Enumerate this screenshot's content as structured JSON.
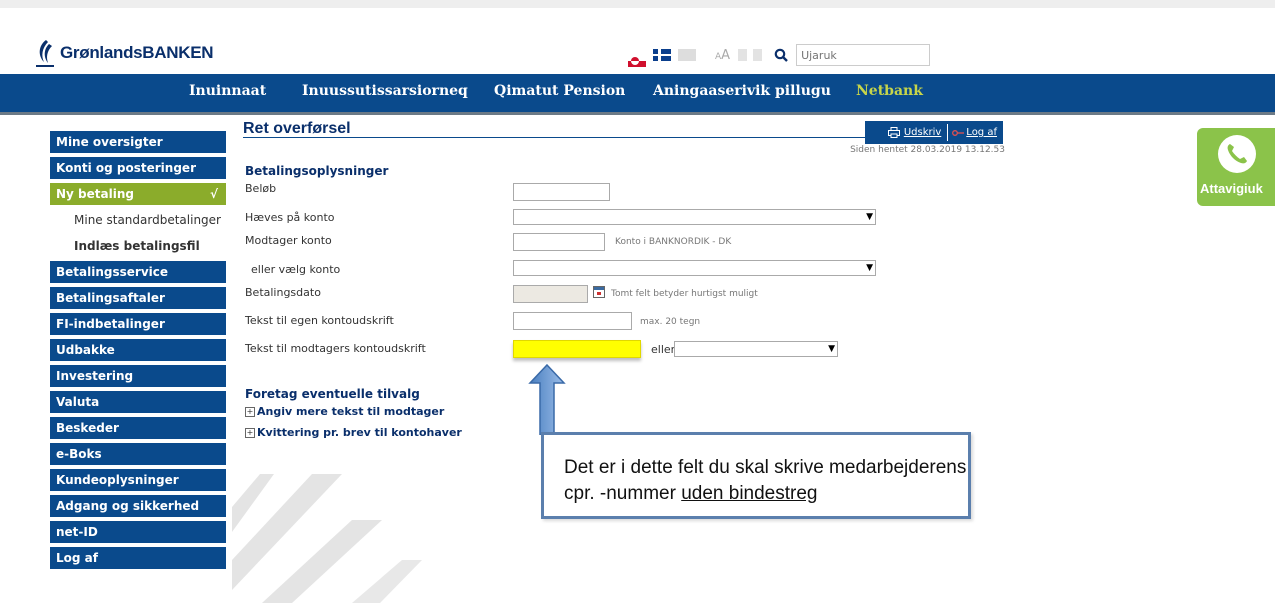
{
  "header": {
    "logo_text": "GrønlandsBANKEN",
    "font_size_label": "A",
    "font_size_small": "A",
    "search_placeholder": "Ujaruk"
  },
  "nav": {
    "items": [
      "Inuinnaat",
      "Inuussutissarsiorneq",
      "Qimatut Pension",
      "Aningaaserivik pillugu",
      "Netbank"
    ]
  },
  "sidebar": {
    "items": [
      "Mine oversigter",
      "Konti og posteringer",
      "Ny betaling",
      "Mine standardbetalinger",
      "Indlæs betalingsfil",
      "Betalingsservice",
      "Betalingsaftaler",
      "FI-indbetalinger",
      "Udbakke",
      "Investering",
      "Valuta",
      "Beskeder",
      "e-Boks",
      "Kundeoplysninger",
      "Adgang og sikkerhed",
      "net-ID",
      "Log af"
    ],
    "check": "√"
  },
  "page": {
    "title": "Ret overførsel",
    "print": "Udskriv",
    "logout": "Log af",
    "fetched": "Siden hentet 28.03.2019 13.12.53"
  },
  "form": {
    "section": "Betalingsoplysninger",
    "amount": "Beløb",
    "from_account": "Hæves på konto",
    "to_account": "Modtager konto",
    "to_account_hint": "Konto i BANKNORDIK - DK",
    "or_choose": "eller vælg konto",
    "date": "Betalingsdato",
    "date_hint": "Tomt felt betyder hurtigst muligt",
    "own_text": "Tekst til egen kontoudskrift",
    "own_text_hint": "max. 20 tegn",
    "recipient_text": "Tekst til modtagers kontoudskrift",
    "or": "eller"
  },
  "options": {
    "section": "Foretag eventuelle tilvalg",
    "more_text": "Angiv mere tekst til modtager",
    "receipt": "Kvittering pr. brev til kontohaver"
  },
  "callout": {
    "line1": "Det er i dette felt du skal skrive medarbejderens",
    "line2_prefix": "cpr. -nummer ",
    "line2_underlined": "uden bindestreg"
  },
  "call_button": {
    "label": "Attavigiuk"
  },
  "colors": {
    "primary": "#0a4a8c",
    "accent": "#8bac2b",
    "highlight": "#ffff00",
    "call": "#8bc34a"
  }
}
